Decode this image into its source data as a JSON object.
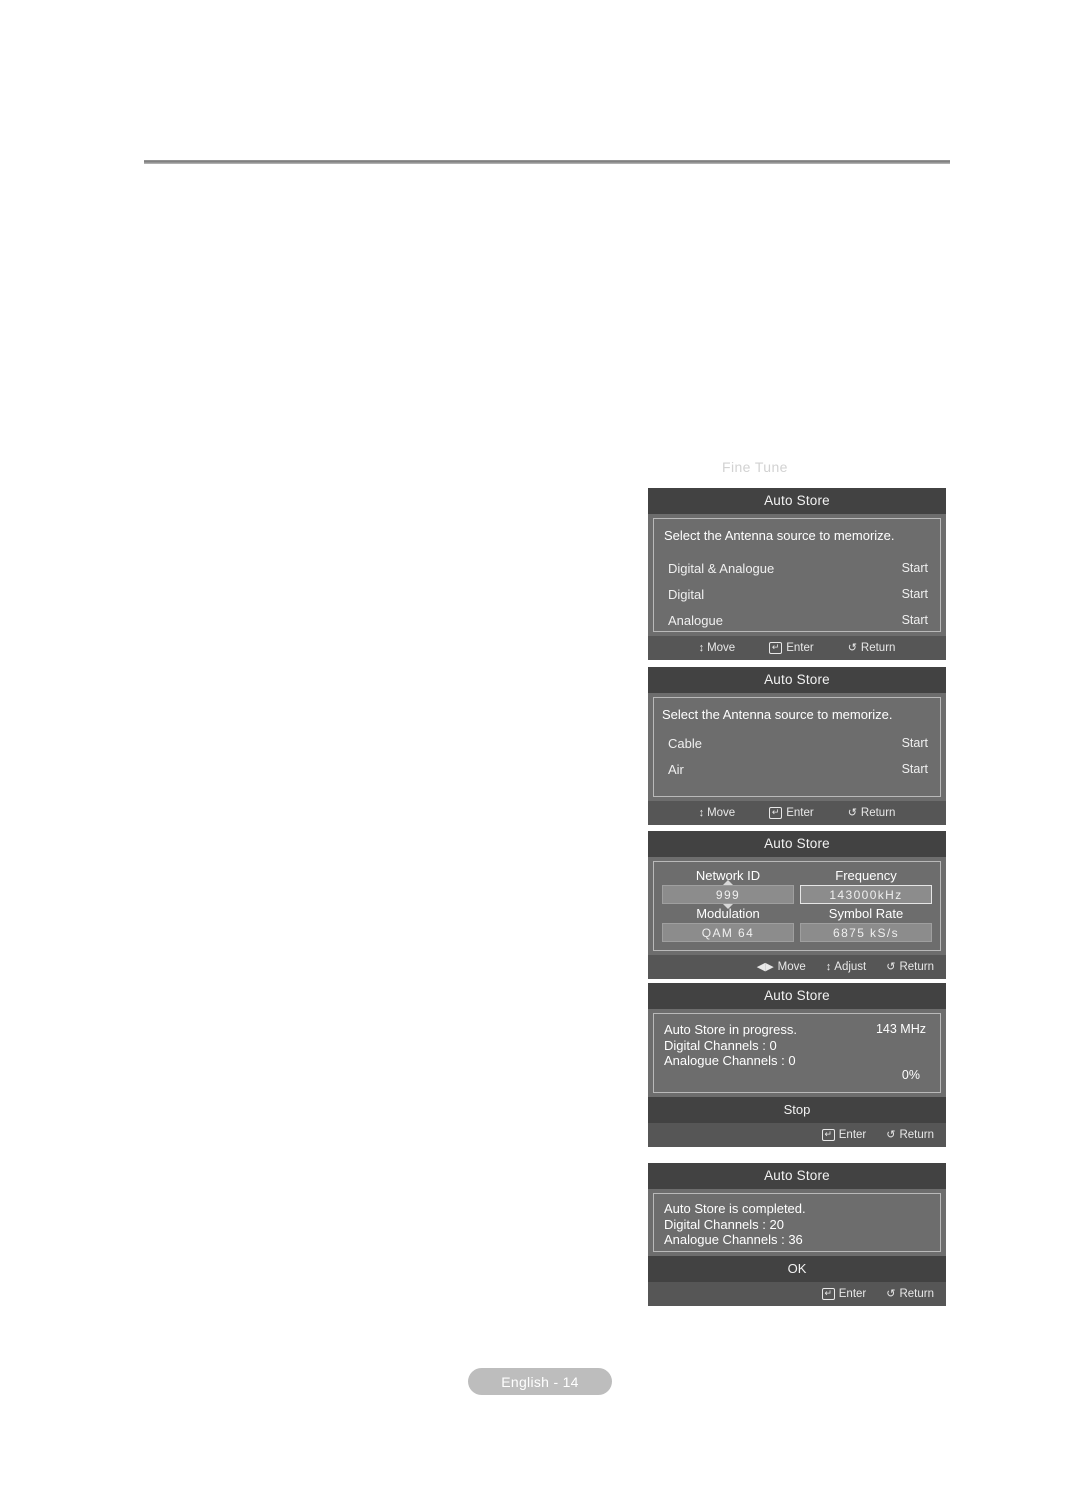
{
  "page": {
    "ghost_caption": "Fine Tune",
    "footer_label": "English - 14"
  },
  "hints": {
    "move": "Move",
    "adjust": "Adjust",
    "enter": "Enter",
    "return": "Return",
    "updown_glyph": "↕",
    "leftright_glyph": "◀▶",
    "enter_glyph": "↵",
    "return_glyph": "↺"
  },
  "panels": [
    {
      "title": "Auto Store",
      "instruction": "Select the Antenna source to memorize.",
      "options": [
        {
          "label": "Digital & Analogue",
          "action": "Start"
        },
        {
          "label": "Digital",
          "action": "Start"
        },
        {
          "label": "Analogue",
          "action": "Start"
        }
      ]
    },
    {
      "title": "Auto Store",
      "instruction": "Select the Antenna source to memorize.",
      "options": [
        {
          "label": "Cable",
          "action": "Start"
        },
        {
          "label": "Air",
          "action": "Start"
        }
      ]
    },
    {
      "title": "Auto Store",
      "fields": [
        {
          "caption": "Network ID",
          "value": "999",
          "selected": false,
          "spinner": true
        },
        {
          "caption": "Frequency",
          "value": "143000kHz",
          "selected": true,
          "spinner": false
        },
        {
          "caption": "Modulation",
          "value": "QAM 64",
          "selected": false,
          "spinner": false
        },
        {
          "caption": "Symbol Rate",
          "value": "6875 kS/s",
          "selected": false,
          "spinner": false
        }
      ]
    },
    {
      "title": "Auto Store",
      "status_lines": "Auto Store in progress.\nDigital Channels : 0\nAnalogue Channels : 0",
      "frequency": "143 MHz",
      "percent": "0%",
      "action": "Stop"
    },
    {
      "title": "Auto Store",
      "status_lines": "Auto Store is completed.\nDigital Channels : 20\nAnalogue Channels : 36",
      "action": "OK"
    }
  ]
}
